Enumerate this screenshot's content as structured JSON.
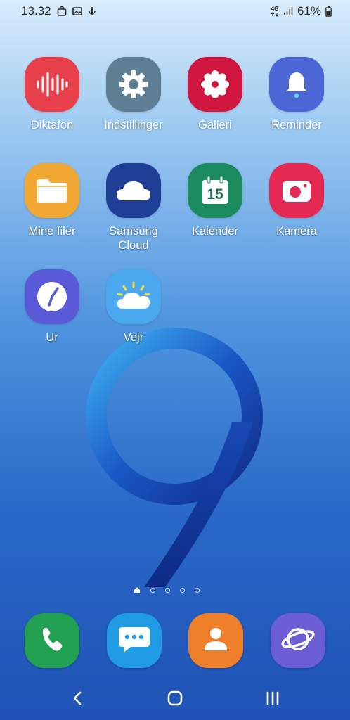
{
  "status_bar": {
    "time": "13.32",
    "network_label": "4G",
    "battery_percent": "61%"
  },
  "apps": [
    {
      "label": "Diktafon",
      "icon": "microphone-waveform-icon",
      "color": "#e8404a"
    },
    {
      "label": "Indstillinger",
      "icon": "gear-icon",
      "color": "#5e7e94"
    },
    {
      "label": "Galleri",
      "icon": "flower-icon",
      "color": "#d0163f"
    },
    {
      "label": "Reminder",
      "icon": "bell-icon",
      "color": "#4b67d6"
    },
    {
      "label": "Mine filer",
      "icon": "folder-icon",
      "color": "#f0a832"
    },
    {
      "label": "Samsung\nCloud",
      "icon": "cloud-icon",
      "color": "#1f3f97"
    },
    {
      "label": "Kalender",
      "icon": "calendar-icon",
      "color": "#1b8a5f",
      "day": "15"
    },
    {
      "label": "Kamera",
      "icon": "camera-icon",
      "color": "#e42a52"
    },
    {
      "label": "Ur",
      "icon": "clock-icon",
      "color": "#5a5ad8"
    },
    {
      "label": "Vejr",
      "icon": "weather-sun-cloud-icon",
      "color": "#4aa9ee"
    }
  ],
  "dock": [
    {
      "name": "phone",
      "icon": "phone-icon",
      "color": "#23a153"
    },
    {
      "name": "messages",
      "icon": "message-bubble-icon",
      "color": "#1e9be2"
    },
    {
      "name": "contacts",
      "icon": "person-icon",
      "color": "#f07f2a"
    },
    {
      "name": "internet",
      "icon": "planet-icon",
      "color": "#6c5fd6"
    }
  ],
  "page_indicator": {
    "pages": 5,
    "current": 0
  },
  "wallpaper": {
    "graphic": "9"
  }
}
